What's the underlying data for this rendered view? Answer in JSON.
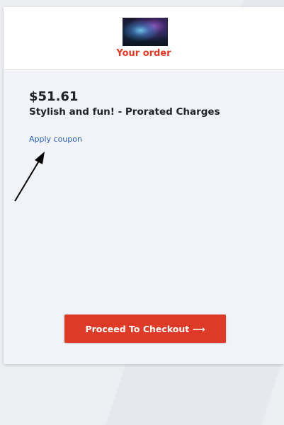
{
  "header": {
    "title": "Your order",
    "thumbnail": "aurora-landscape-image"
  },
  "order": {
    "price": "$51.61",
    "product_name": "Stylish and fun! - Prorated Charges",
    "coupon_link": "Apply coupon"
  },
  "actions": {
    "checkout_label": "Proceed To Checkout ⟶"
  },
  "colors": {
    "accent": "#dd3b27",
    "link": "#2a5db0",
    "text": "#1f2127",
    "panel": "#f2f3f8"
  }
}
